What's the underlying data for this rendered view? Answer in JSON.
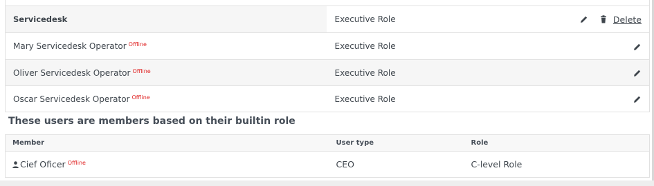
{
  "roles_table": {
    "rows": [
      {
        "name": "Servicedesk",
        "offline": "",
        "role": "Executive Role",
        "is_group": true,
        "delete_label": "Delete"
      },
      {
        "name": "Mary Servicedesk Operator",
        "offline": "Offline",
        "role": "Executive Role"
      },
      {
        "name": "Oliver Servicedesk Operator",
        "offline": "Offline",
        "role": "Executive Role"
      },
      {
        "name": "Oscar Servicedesk Operator",
        "offline": "Offline",
        "role": "Executive Role"
      }
    ]
  },
  "builtin_section": {
    "heading": "These users are members based on their builtin role",
    "columns": {
      "member": "Member",
      "user_type": "User type",
      "role": "Role"
    },
    "rows": [
      {
        "member": "Cief Oficer",
        "offline": "Offline",
        "user_type": "CEO",
        "role": "C-level Role"
      }
    ]
  },
  "icons": {
    "edit": "pencil-icon",
    "delete": "trash-icon",
    "user": "user-icon"
  },
  "colors": {
    "offline": "#e02424",
    "row_stripe": "#f6f6f6",
    "border": "#e1e1e1"
  }
}
